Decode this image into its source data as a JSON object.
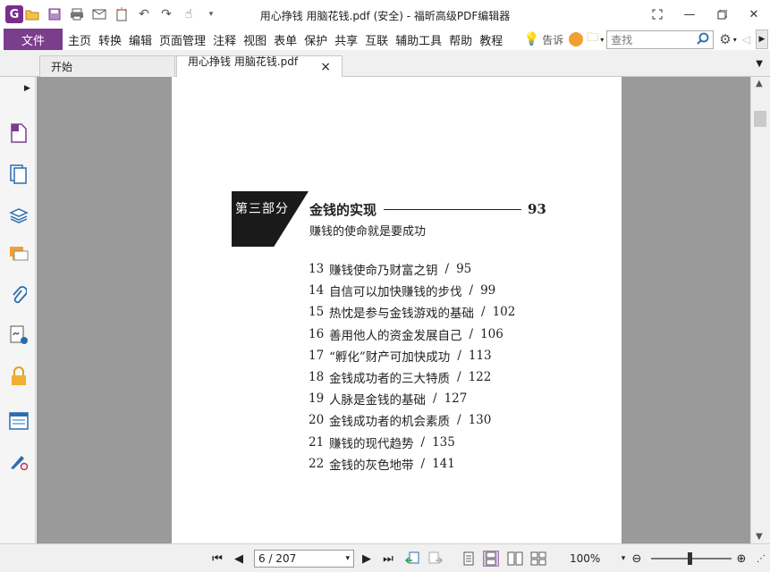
{
  "window": {
    "title": "用心挣钱 用脑花钱.pdf (安全) - 福昕高级PDF编辑器"
  },
  "menubar": {
    "file": "文件",
    "items": [
      "主页",
      "转换",
      "编辑",
      "页面管理",
      "注释",
      "视图",
      "表单",
      "保护",
      "共享",
      "互联",
      "辅助工具",
      "帮助",
      "教程"
    ],
    "tip_label": "告诉",
    "search_placeholder": "查找"
  },
  "tabs": [
    {
      "label": "开始",
      "active": false
    },
    {
      "label": "用心挣钱 用脑花钱.pdf ...",
      "active": true
    }
  ],
  "document": {
    "part_label": "第三部分",
    "section_title": "金钱的实现",
    "section_page": "93",
    "section_subtitle": "赚钱的使命就是要成功",
    "toc": [
      {
        "num": "13",
        "title": "赚钱使命乃财富之钥",
        "page": "95"
      },
      {
        "num": "14",
        "title": "自信可以加快赚钱的步伐",
        "page": "99"
      },
      {
        "num": "15",
        "title": "热忱是参与金钱游戏的基础",
        "page": "102"
      },
      {
        "num": "16",
        "title": "善用他人的资金发展自己",
        "page": "106"
      },
      {
        "num": "17",
        "title": "“孵化”财产可加快成功",
        "page": "113"
      },
      {
        "num": "18",
        "title": "金钱成功者的三大特质",
        "page": "122"
      },
      {
        "num": "19",
        "title": "人脉是金钱的基础",
        "page": "127"
      },
      {
        "num": "20",
        "title": "金钱成功者的机会素质",
        "page": "130"
      },
      {
        "num": "21",
        "title": "赚钱的现代趋势",
        "page": "135"
      },
      {
        "num": "22",
        "title": "金钱的灰色地带",
        "page": "141"
      }
    ],
    "separator": "/"
  },
  "statusbar": {
    "page_indicator": "6 / 207",
    "zoom": "100%"
  },
  "colors": {
    "accent": "#7b3e8d",
    "doc_background": "#9a9a9a"
  }
}
